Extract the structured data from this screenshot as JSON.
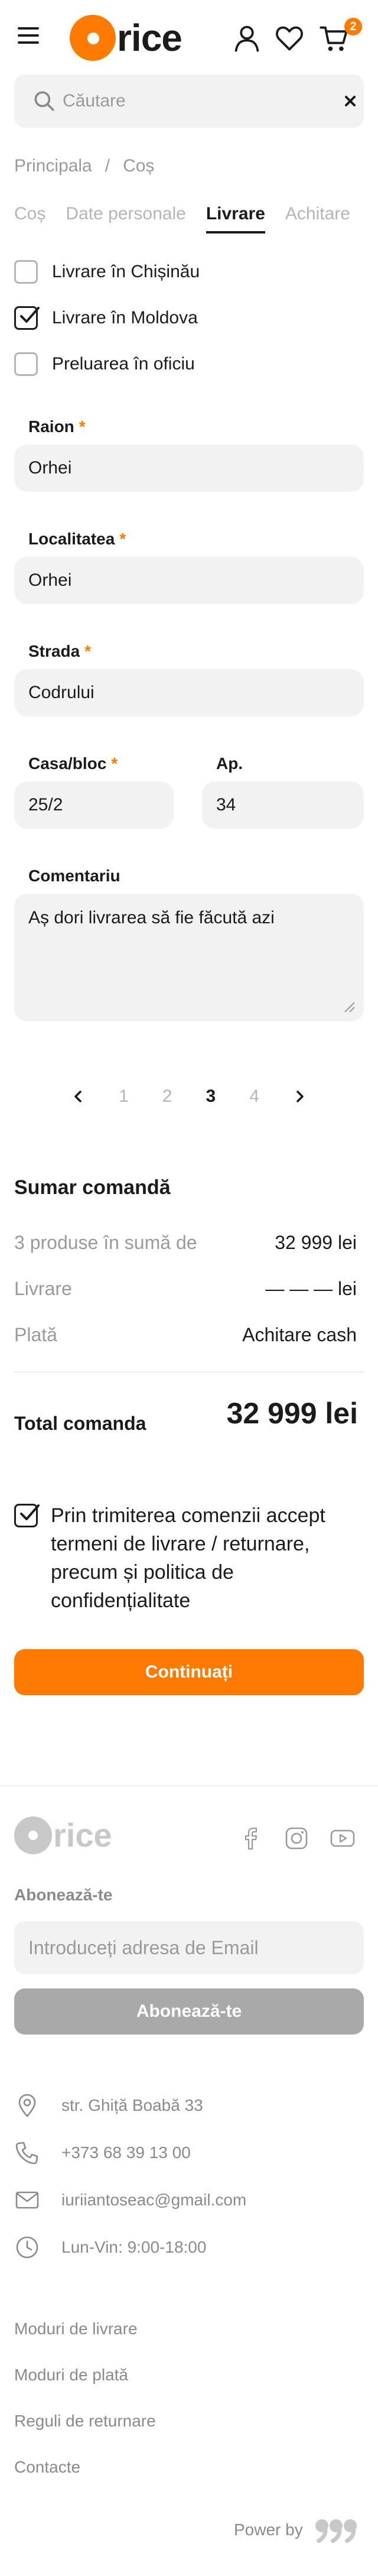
{
  "header": {
    "logo_text": "rice",
    "cart_count": "2",
    "icons": [
      "menu-icon",
      "user-icon",
      "heart-icon",
      "cart-icon"
    ],
    "accent": "#ff7a00"
  },
  "search": {
    "placeholder": "Căutare",
    "value": ""
  },
  "breadcrumb": {
    "home": "Principala",
    "sep": "/",
    "current": "Coș"
  },
  "steps": [
    "Coș",
    "Date personale",
    "Livrare",
    "Achitare"
  ],
  "delivery_options": [
    {
      "label": "Livrare în Chișinău",
      "checked": false
    },
    {
      "label": "Livrare în Moldova",
      "checked": true
    },
    {
      "label": "Preluarea în oficiu",
      "checked": false
    }
  ],
  "form": {
    "raion": {
      "label": "Raion",
      "req": "*",
      "value": "Orhei"
    },
    "localitatea": {
      "label": "Localitatea",
      "req": "*",
      "value": "Orhei"
    },
    "strada": {
      "label": "Strada",
      "req": "*",
      "value": "Codrului"
    },
    "casa": {
      "label": "Casa/bloc",
      "req": "*",
      "value": "25/2"
    },
    "ap": {
      "label": "Ap.",
      "value": "34"
    },
    "comentariu": {
      "label": "Comentariu",
      "value": "Aș dori livrarea să fie făcută azi"
    }
  },
  "pager": {
    "prev": "‹",
    "pages": [
      "1",
      "2",
      "3",
      "4"
    ],
    "current": "3",
    "next": "›"
  },
  "summary": {
    "title": "Sumar comandă",
    "rows": [
      {
        "key": "3 produse în sumă de",
        "value": "32 999 lei"
      },
      {
        "key": "Livrare",
        "value": "— — — lei"
      },
      {
        "key": "Plată",
        "value": "Achitare cash"
      }
    ],
    "total_label": "Total comanda",
    "total_value": "32 999 lei"
  },
  "consent": {
    "text": "Prin trimiterea comenzii accept termeni de livrare / returnare, precum și politica de confidențialitate",
    "checked": true
  },
  "cta": {
    "label": "Continuați"
  },
  "footer": {
    "logo_text": "rice",
    "subscribe_title": "Abonează-te",
    "email_placeholder": "Introduceți adresa de Email",
    "subscribe_button": "Abonează-te",
    "contacts": [
      {
        "icon": "location-pin-icon",
        "text": "str. Ghiță Boabă 33"
      },
      {
        "icon": "phone-icon",
        "text": "+373 68 39 13 00"
      },
      {
        "icon": "mail-icon",
        "text": "iuriiantoseac@gmail.com"
      },
      {
        "icon": "clock-icon",
        "text": "Lun-Vin: 9:00-18:00"
      }
    ],
    "links": [
      "Moduri de livrare",
      "Moduri de plată",
      "Reguli de returnare",
      "Contacte"
    ],
    "power_by": "Power by"
  }
}
